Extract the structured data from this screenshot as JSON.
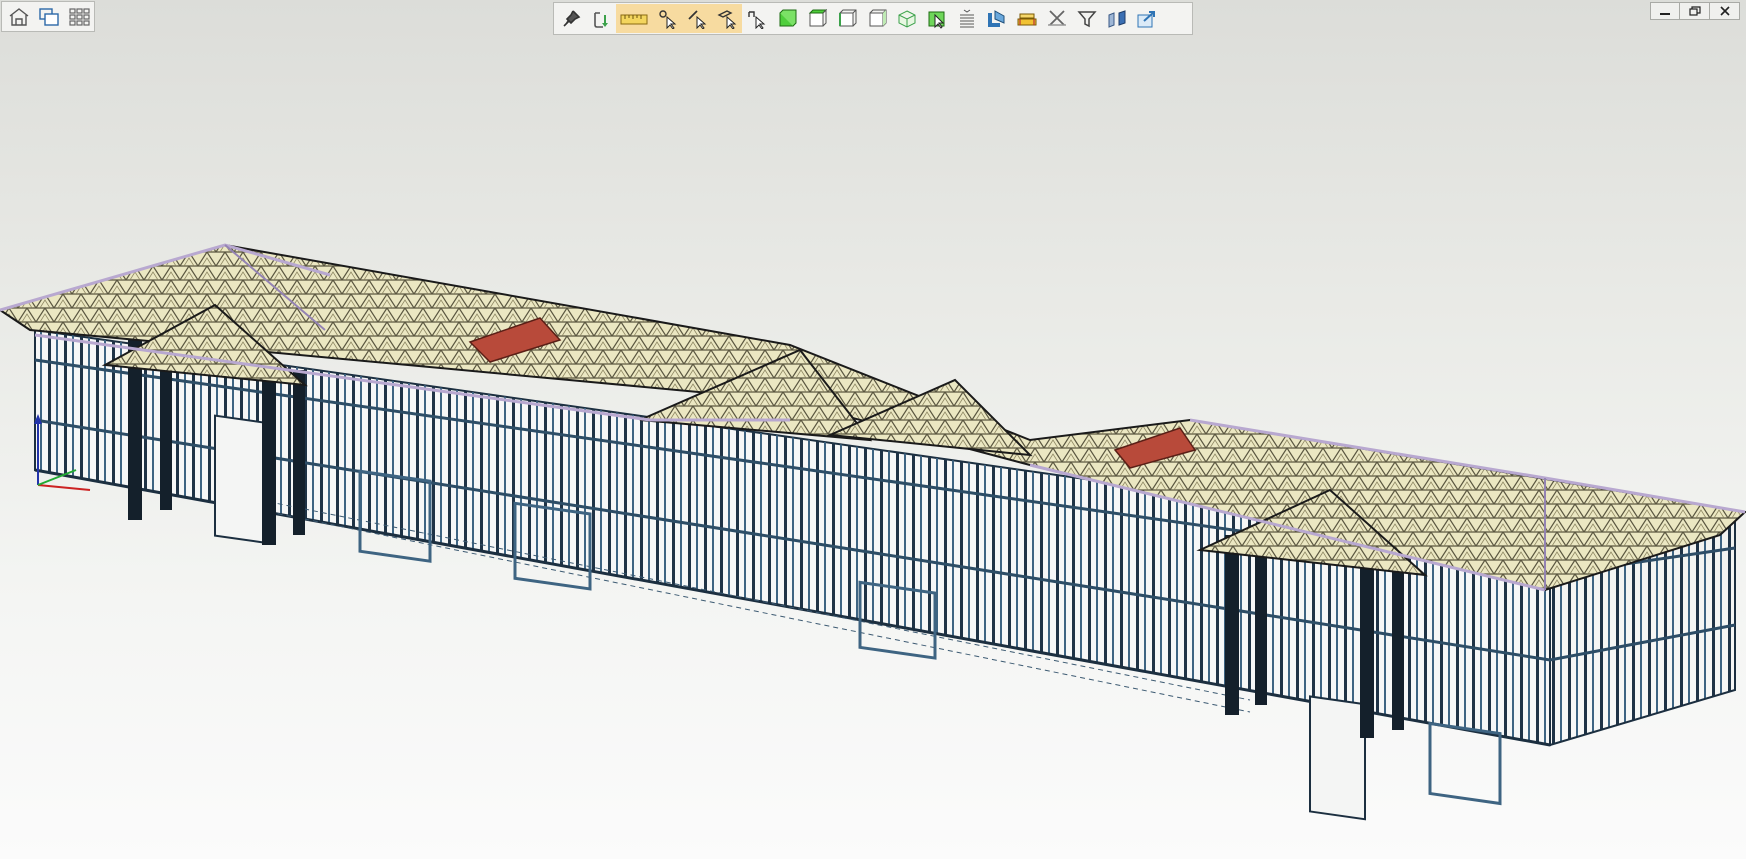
{
  "app": {
    "accent": "#f7dba0",
    "frame_color": "#2d4d66",
    "truss_color": "#e3dfb0",
    "chord_color": "#b8a8d0",
    "roof_patch_color": "#b84a3a"
  },
  "left_toolbar": {
    "items": [
      {
        "icon": "house-view-icon"
      },
      {
        "icon": "cascade-windows-icon"
      },
      {
        "icon": "tile-windows-icon"
      }
    ]
  },
  "main_toolbar": {
    "items": [
      {
        "icon": "pin-icon",
        "active": false
      },
      {
        "icon": "orbit-rotate-icon",
        "active": false
      },
      {
        "icon": "ruler-measure-icon",
        "active": true
      },
      {
        "icon": "snap-point-icon",
        "active": true
      },
      {
        "icon": "snap-edge-icon",
        "active": true
      },
      {
        "icon": "snap-face-icon",
        "active": true
      },
      {
        "icon": "select-arrow-icon",
        "active": false
      },
      {
        "icon": "solid-view-icon",
        "active": false
      },
      {
        "icon": "top-view-icon",
        "active": false
      },
      {
        "icon": "side-view-icon",
        "active": false
      },
      {
        "icon": "front-view-icon",
        "active": false
      },
      {
        "icon": "iso-view-icon",
        "active": false
      },
      {
        "icon": "select-box-icon",
        "active": false
      },
      {
        "icon": "list-panel-icon",
        "active": false
      },
      {
        "icon": "section-icon",
        "active": false
      },
      {
        "icon": "layers-icon",
        "active": false
      },
      {
        "icon": "clear-cut-icon",
        "active": false
      },
      {
        "icon": "filter-icon",
        "active": false
      },
      {
        "icon": "mirror-icon",
        "active": false
      },
      {
        "icon": "export-icon",
        "active": false
      }
    ]
  },
  "window_controls": {
    "items": [
      {
        "icon": "minimize-icon"
      },
      {
        "icon": "restore-icon"
      },
      {
        "icon": "close-icon"
      }
    ]
  }
}
